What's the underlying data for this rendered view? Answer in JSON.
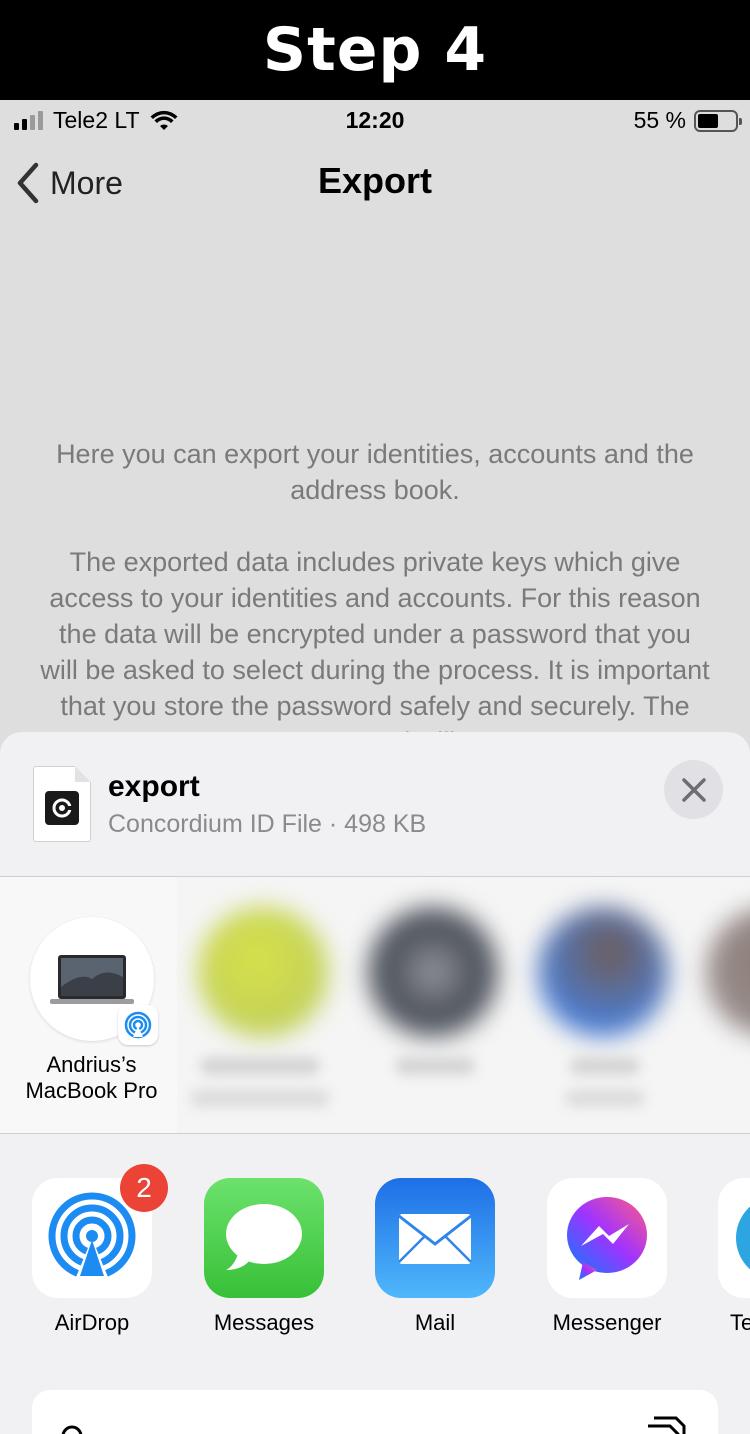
{
  "banner": {
    "text": "Step 4"
  },
  "status_bar": {
    "carrier": "Tele2 LT",
    "time": "12:20",
    "battery_text": "55 %",
    "battery_level": 0.55
  },
  "nav": {
    "back_label": "More",
    "title": "Export"
  },
  "body": {
    "paragraph1": "Here you can export your identities, accounts and the address book.",
    "paragraph2": "The exported data includes private keys which give access to your identities and accounts. For this reason the data will be encrypted under a password that you will be asked to select during the process. It is important that you store the password safely and securely. The password will"
  },
  "share_sheet": {
    "file": {
      "name": "export",
      "meta": "Concordium ID File · 498 KB",
      "icon": "concordium-file-icon"
    },
    "close_icon": "close-icon",
    "people": [
      {
        "name_line1": "Andrius’s",
        "name_line2": "MacBook Pro",
        "icon": "macbook-icon"
      }
    ],
    "apps": [
      {
        "label": "AirDrop",
        "icon": "airdrop-icon",
        "badge": "2",
        "color": "#1d8cf2"
      },
      {
        "label": "Messages",
        "icon": "messages-icon",
        "color": "#4cd964"
      },
      {
        "label": "Mail",
        "icon": "mail-icon",
        "color": "#1e74e8"
      },
      {
        "label": "Messenger",
        "icon": "messenger-icon",
        "color": "#a335f0"
      },
      {
        "label": "Te",
        "icon": "telegram-icon",
        "color": "#2ca5e0"
      }
    ]
  }
}
